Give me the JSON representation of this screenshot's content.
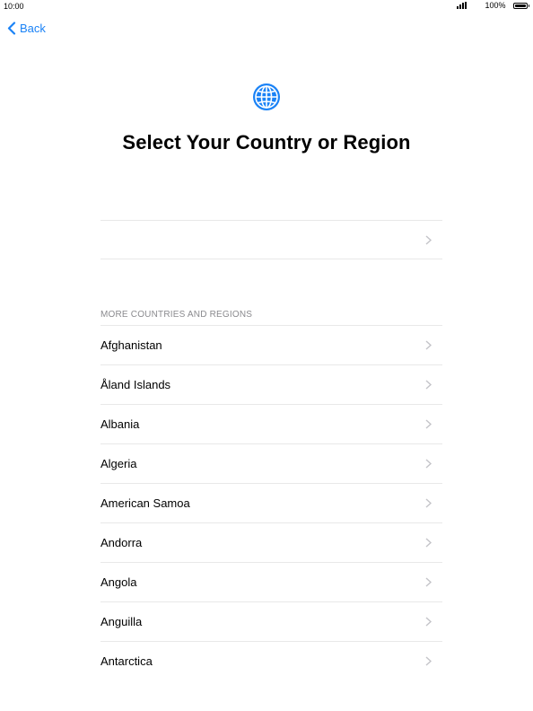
{
  "status_bar": {
    "time": "10:00",
    "battery_percent": "100%",
    "battery_level": 1.0
  },
  "nav": {
    "back_label": "Back"
  },
  "header": {
    "icon": "globe-icon",
    "title": "Select Your Country or Region"
  },
  "suggested": {
    "items": [
      {
        "label": ""
      }
    ]
  },
  "more_section": {
    "header": "MORE COUNTRIES AND REGIONS",
    "items": [
      {
        "label": "Afghanistan"
      },
      {
        "label": "Åland Islands"
      },
      {
        "label": "Albania"
      },
      {
        "label": "Algeria"
      },
      {
        "label": "American Samoa"
      },
      {
        "label": "Andorra"
      },
      {
        "label": "Angola"
      },
      {
        "label": "Anguilla"
      },
      {
        "label": "Antarctica"
      }
    ]
  },
  "colors": {
    "accent": "#1a82f6",
    "separator": "#e8e8e8",
    "chevron": "#c3c3c8",
    "section_header": "#8a8a8e"
  }
}
